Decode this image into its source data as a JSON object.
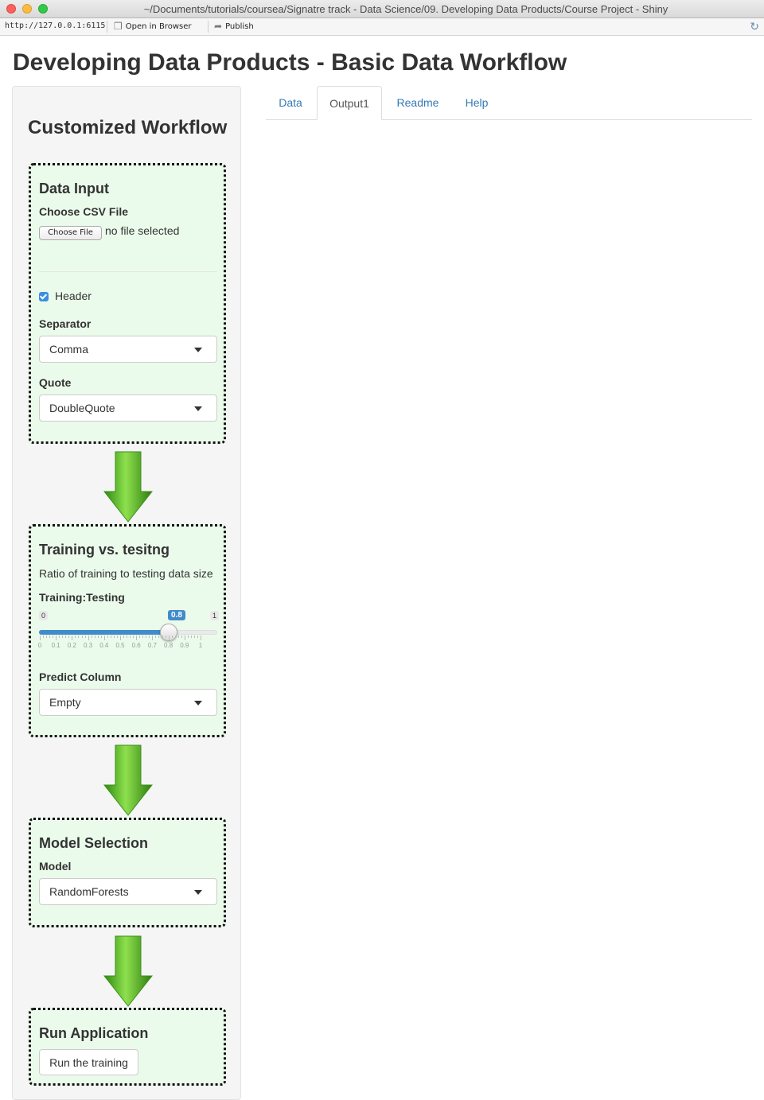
{
  "window": {
    "title": "~/Documents/tutorials/coursea/Signatre track - Data Science/09. Developing Data Products/Course Project - Shiny"
  },
  "toolbar": {
    "url": "http://127.0.0.1:6115",
    "open_in_browser": "Open in Browser",
    "publish": "Publish"
  },
  "app": {
    "title": "Developing Data Products - Basic Data Workflow"
  },
  "sidebar": {
    "heading": "Customized Workflow",
    "data_input": {
      "heading": "Data Input",
      "file_label": "Choose CSV File",
      "file_button": "Choose File",
      "file_status": "no file selected",
      "header_label": "Header",
      "header_checked": true,
      "separator_label": "Separator",
      "separator_value": "Comma",
      "quote_label": "Quote",
      "quote_value": "DoubleQuote"
    },
    "training": {
      "heading": "Training vs. tesitng",
      "description": "Ratio of training to testing data size",
      "slider_label": "Training:Testing",
      "slider_min": "0",
      "slider_max": "1",
      "slider_value": "0.8",
      "slider_fraction": 0.8,
      "ticks": [
        "0",
        "0.1",
        "0.2",
        "0.3",
        "0.4",
        "0.5",
        "0.6",
        "0.7",
        "0.8",
        "0.9",
        "1"
      ],
      "predict_label": "Predict Column",
      "predict_value": "Empty"
    },
    "model": {
      "heading": "Model Selection",
      "model_label": "Model",
      "model_value": "RandomForests"
    },
    "run": {
      "heading": "Run Application",
      "button": "Run the training"
    }
  },
  "tabs": [
    {
      "label": "Data",
      "active": false
    },
    {
      "label": "Output1",
      "active": true
    },
    {
      "label": "Readme",
      "active": false
    },
    {
      "label": "Help",
      "active": false
    }
  ],
  "colors": {
    "panel_bg": "#ebfbeb",
    "accent": "#428bca",
    "link": "#337ab7",
    "arrow_green": "#4caf1e"
  }
}
